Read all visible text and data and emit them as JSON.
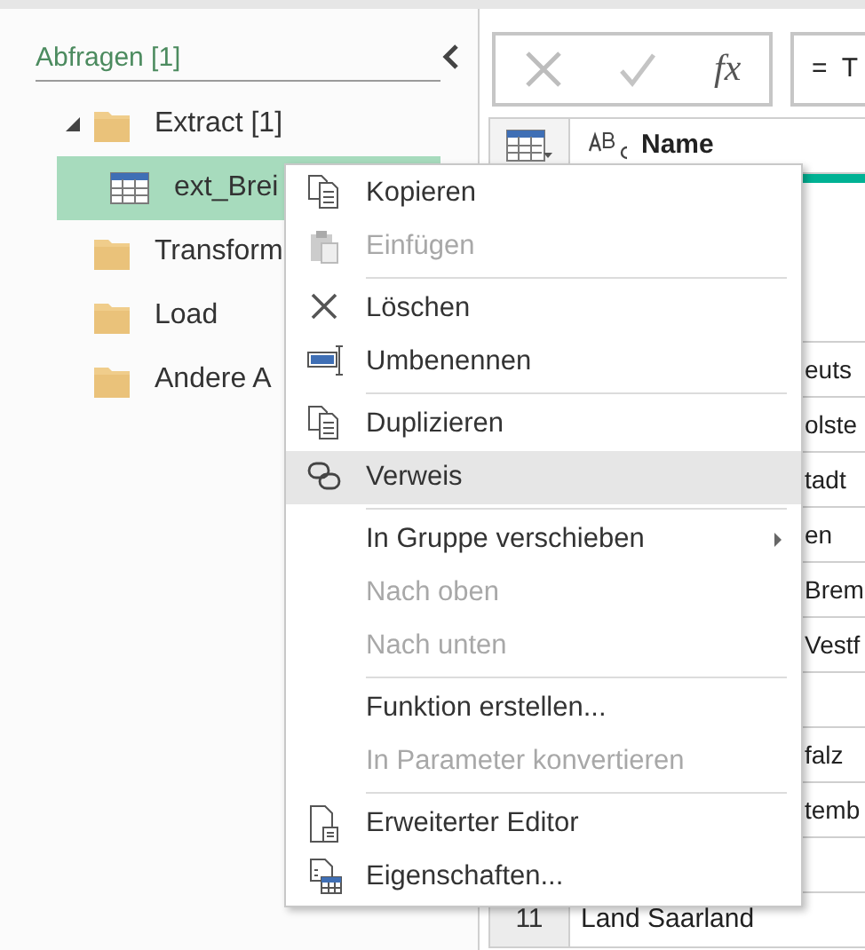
{
  "queries_pane": {
    "title": "Abfragen [1]",
    "tree": [
      {
        "label": "Extract [1]",
        "kind": "folder",
        "expanded": true,
        "selected": false,
        "children": [
          {
            "label": "ext_Brei",
            "kind": "table",
            "selected": true
          }
        ]
      },
      {
        "label": "Transform",
        "kind": "folder",
        "selected": false
      },
      {
        "label": "Load",
        "kind": "folder",
        "selected": false
      },
      {
        "label": "Andere A",
        "kind": "folder",
        "selected": false
      }
    ]
  },
  "formula_bar": {
    "fx_label": "fx",
    "formula": "=  T"
  },
  "table": {
    "columns": [
      {
        "name": "Name"
      }
    ],
    "rows": [
      {
        "number": "",
        "cell": "euts"
      },
      {
        "number": "",
        "cell": "olste"
      },
      {
        "number": "",
        "cell": "tadt"
      },
      {
        "number": "",
        "cell": "en"
      },
      {
        "number": "",
        "cell": "Brem"
      },
      {
        "number": "",
        "cell": "Vestf"
      },
      {
        "number": "",
        "cell": ""
      },
      {
        "number": "",
        "cell": "falz"
      },
      {
        "number": "",
        "cell": "temb"
      },
      {
        "number": "",
        "cell": ""
      },
      {
        "number": "11",
        "cell": "Land Saarland"
      }
    ]
  },
  "context_menu": [
    {
      "kind": "item",
      "label": "Kopieren",
      "disabled": false,
      "selected": false
    },
    {
      "kind": "item",
      "label": "Einfügen",
      "disabled": true,
      "selected": false
    },
    {
      "kind": "separator"
    },
    {
      "kind": "item",
      "label": "Löschen",
      "disabled": false,
      "selected": false
    },
    {
      "kind": "item",
      "label": "Umbenennen",
      "disabled": false,
      "selected": false
    },
    {
      "kind": "separator"
    },
    {
      "kind": "item",
      "label": "Duplizieren",
      "disabled": false,
      "selected": false
    },
    {
      "kind": "item",
      "label": "Verweis",
      "disabled": false,
      "selected": true
    },
    {
      "kind": "separator"
    },
    {
      "kind": "submenu",
      "label": "In Gruppe verschieben",
      "disabled": false,
      "selected": false
    },
    {
      "kind": "item",
      "label": "Nach oben",
      "disabled": true,
      "selected": false
    },
    {
      "kind": "item",
      "label": "Nach unten",
      "disabled": true,
      "selected": false
    },
    {
      "kind": "separator"
    },
    {
      "kind": "item",
      "label": "Funktion erstellen...",
      "disabled": false,
      "selected": false
    },
    {
      "kind": "item",
      "label": "In Parameter konvertieren",
      "disabled": true,
      "selected": false
    },
    {
      "kind": "separator"
    },
    {
      "kind": "item",
      "label": "Erweiterter Editor",
      "disabled": false,
      "selected": false
    },
    {
      "kind": "item",
      "label": "Eigenschaften...",
      "disabled": false,
      "selected": false
    }
  ]
}
